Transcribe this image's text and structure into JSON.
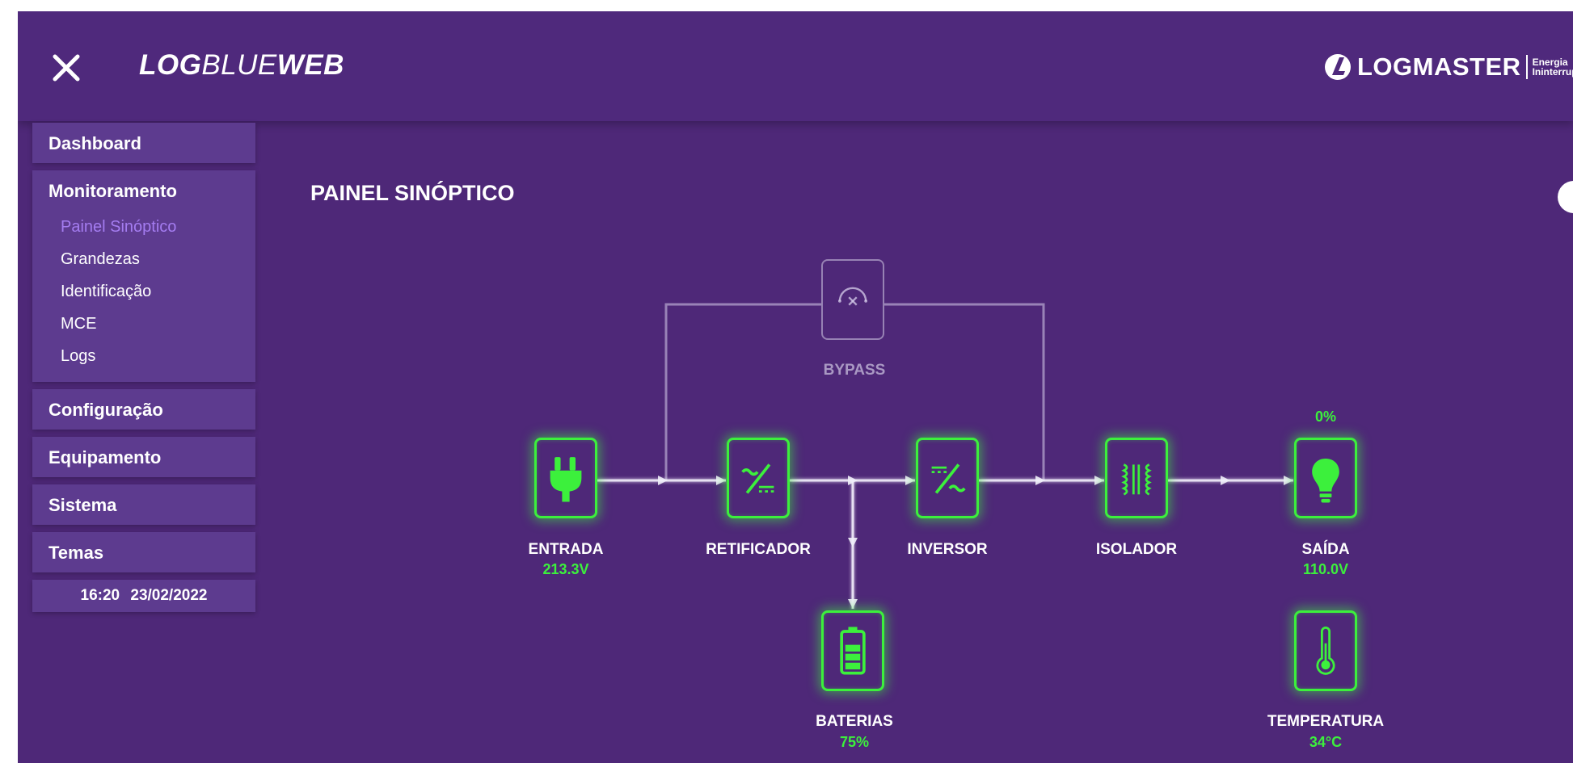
{
  "header": {
    "title_bold_1": "LOG",
    "title_normal": "BLUE",
    "title_bold_2": "WEB",
    "brand_name": "LOGMASTER",
    "brand_sub_1": "Energia",
    "brand_sub_2": "Ininterrup"
  },
  "sidebar": {
    "dashboard": "Dashboard",
    "monitoramento": "Monitoramento",
    "monitoramento_items": [
      "Painel Sinóptico",
      "Grandezas",
      "Identificação",
      "MCE",
      "Logs"
    ],
    "configuracao": "Configuração",
    "equipamento": "Equipamento",
    "sistema": "Sistema",
    "temas": "Temas",
    "clock_time": "16:20",
    "clock_date": "23/02/2022"
  },
  "page": {
    "title": "PAINEL SINÓPTICO"
  },
  "diagram": {
    "bypass": {
      "label": "BYPASS"
    },
    "entrada": {
      "label": "ENTRADA",
      "value": "213.3V"
    },
    "retificador": {
      "label": "RETIFICADOR"
    },
    "inversor": {
      "label": "INVERSOR"
    },
    "isolador": {
      "label": "ISOLADOR"
    },
    "saida": {
      "label": "SAÍDA",
      "value": "110.0V",
      "load": "0%"
    },
    "baterias": {
      "label": "BATERIAS",
      "value": "75%"
    },
    "temperatura": {
      "label": "TEMPERATURA",
      "value": "34°C"
    }
  },
  "colors": {
    "background": "#4e2878",
    "active_green": "#3cf03c",
    "active_menu": "#a47cf0"
  }
}
